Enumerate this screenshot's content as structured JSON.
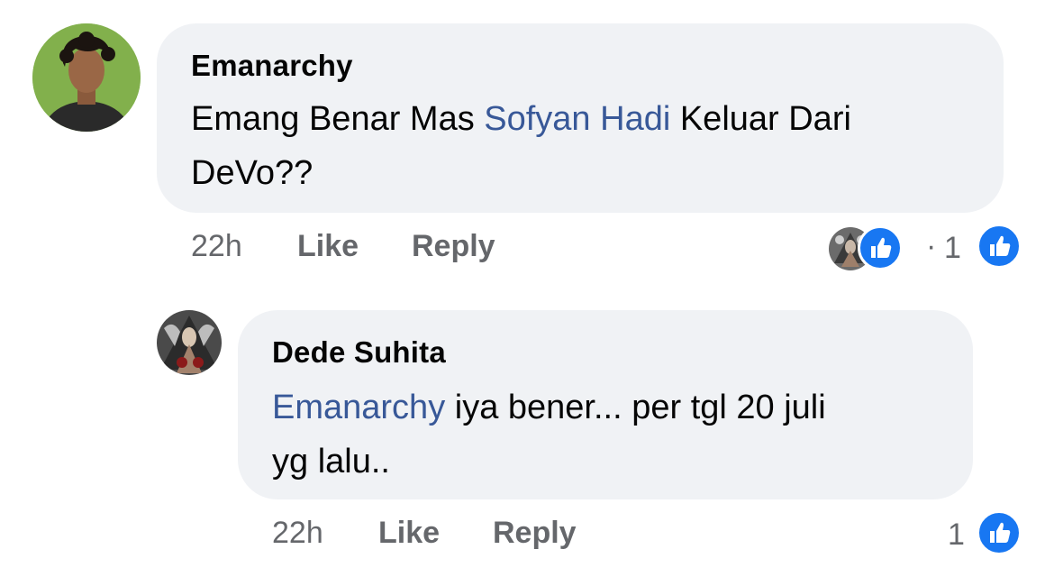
{
  "comments": [
    {
      "author": "Emanarchy",
      "text_line1_before": "Emang Benar Mas ",
      "text_mention": "Sofyan Hadi",
      "text_line1_after": " Keluar Dari",
      "text_line2": "DeVo??",
      "time": "22h",
      "like_label": "Like",
      "reply_label": "Reply",
      "reaction_separator": "·",
      "reaction_count": "1",
      "reaction_icon": "thumbs-up-icon"
    },
    {
      "author": "Dede Suhita",
      "text_mention": "Emanarchy",
      "text_line1_after": " iya bener... per tgl 20 juli",
      "text_line2": "yg lalu..",
      "time": "22h",
      "like_label": "Like",
      "reply_label": "Reply",
      "reaction_count": "1",
      "reaction_icon": "thumbs-up-icon"
    }
  ],
  "colors": {
    "bubble_bg": "#f0f2f5",
    "mention": "#385898",
    "meta_gray": "#65676b",
    "like_blue": "#1877f2"
  }
}
